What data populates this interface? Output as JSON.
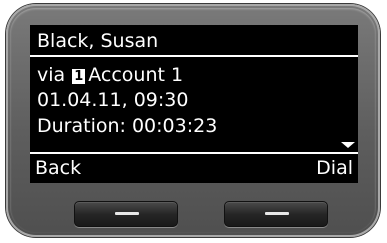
{
  "screen": {
    "title": "Black, Susan",
    "via_prefix": "via",
    "account_badge": "1",
    "account_name": "Account 1",
    "datetime": "01.04.11, 09:30",
    "duration": "Duration: 00:03:23",
    "scroll_indicator": "chevron-down-icon"
  },
  "softkeys": {
    "left_label": "Back",
    "right_label": "Dial"
  },
  "colors": {
    "screen_background": "#000000",
    "screen_text": "#ffffff",
    "bezel": "#6a6a6a"
  }
}
